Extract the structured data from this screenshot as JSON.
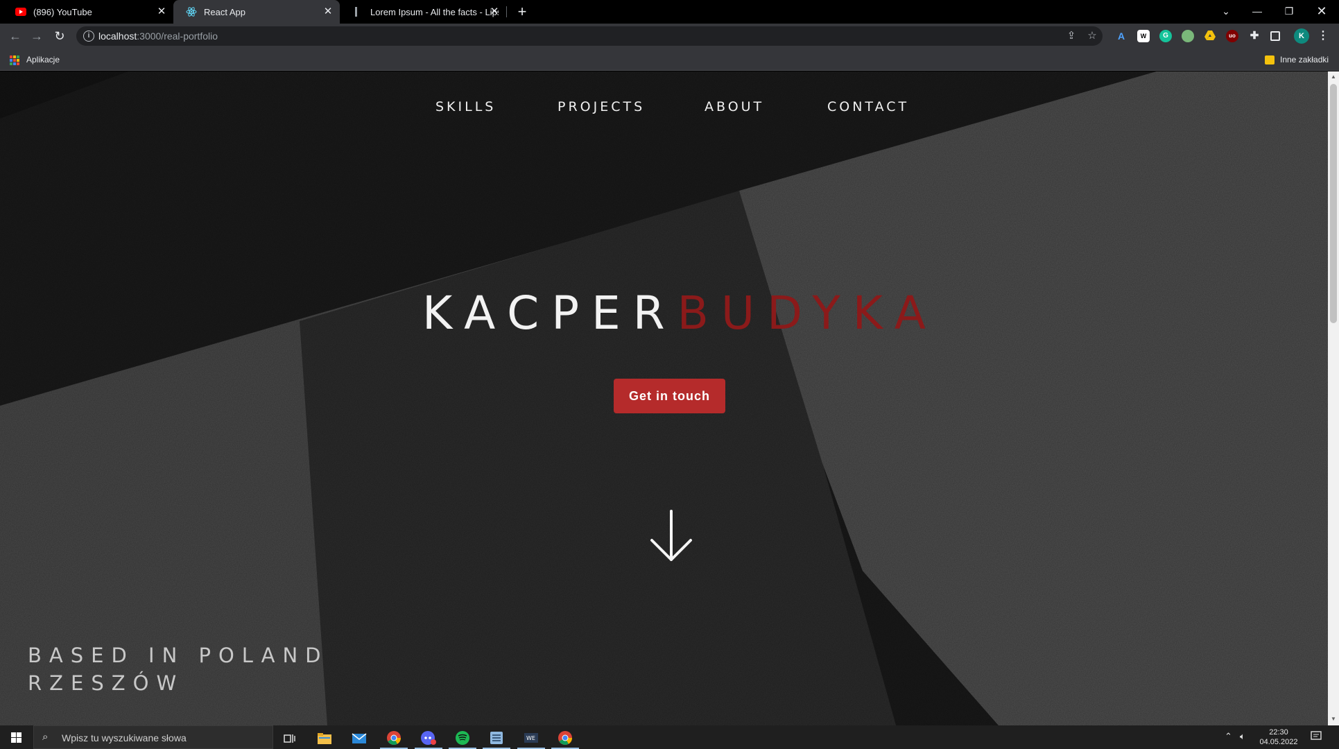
{
  "browser": {
    "tabs": [
      {
        "title": "(896) YouTube",
        "active": false,
        "favicon": "youtube-icon"
      },
      {
        "title": "React App",
        "active": true,
        "favicon": "react-icon"
      },
      {
        "title": "Lorem Ipsum - All the facts - Lips",
        "active": false,
        "favicon": "lipsum-icon"
      }
    ],
    "new_tab_label": "+",
    "url_host": "localhost",
    "url_path": ":3000/real-portfolio",
    "bookmarks": {
      "apps_label": "Aplikacje",
      "other_label": "Inne zakładki"
    },
    "profile_initial": "K"
  },
  "page": {
    "nav": [
      "SKILLS",
      "PROJECTS",
      "ABOUT",
      "CONTACT"
    ],
    "hero_first": "KACPER",
    "hero_last": "BUDYKA",
    "cta_label": "Get in touch",
    "location_line1": "BASED IN POLAND",
    "location_line2": "RZESZÓW",
    "colors": {
      "accent": "#b52b2b",
      "hero_last": "#8b1a1a"
    }
  },
  "taskbar": {
    "search_placeholder": "Wpisz tu wyszukiwane słowa",
    "time": "22:30",
    "date": "04.05.2022",
    "apps": [
      "task-view-icon",
      "file-explorer-icon",
      "mail-icon",
      "chrome-icon",
      "discord-icon",
      "spotify-icon",
      "notepad-icon",
      "jetbrains-icon",
      "chrome-icon"
    ]
  }
}
